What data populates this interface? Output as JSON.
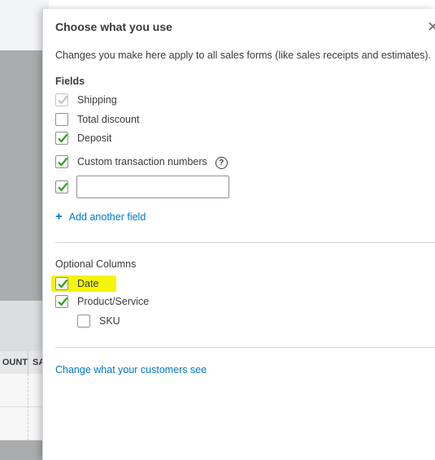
{
  "background": {
    "column_header_1": "OUNT",
    "column_header_2": "SA"
  },
  "panel": {
    "title": "Choose what you use",
    "close_symbol": "✕",
    "description": "Changes you make here apply to all sales forms (like sales receipts and estimates).",
    "fields_section": {
      "title": "Fields",
      "items": [
        {
          "label": "Shipping",
          "checked": true,
          "disabled": true
        },
        {
          "label": "Total discount",
          "checked": false
        },
        {
          "label": "Deposit",
          "checked": true
        },
        {
          "label": "Custom transaction numbers",
          "checked": true,
          "help_icon": "?"
        }
      ],
      "custom_field": {
        "checked": true,
        "value": ""
      },
      "add_link": "Add another field",
      "add_icon": "+"
    },
    "optional_columns": {
      "title": "Optional Columns",
      "items": [
        {
          "label": "Date",
          "checked": true,
          "highlighted": true
        },
        {
          "label": "Product/Service",
          "checked": true
        },
        {
          "label": "SKU",
          "checked": false
        }
      ]
    },
    "footer_link": "Change what your customers see"
  },
  "colors": {
    "check_green": "#2ca01c",
    "link_blue": "#0077c5",
    "highlight_yellow": "#f4f40c",
    "text_dark": "#393a3d"
  }
}
